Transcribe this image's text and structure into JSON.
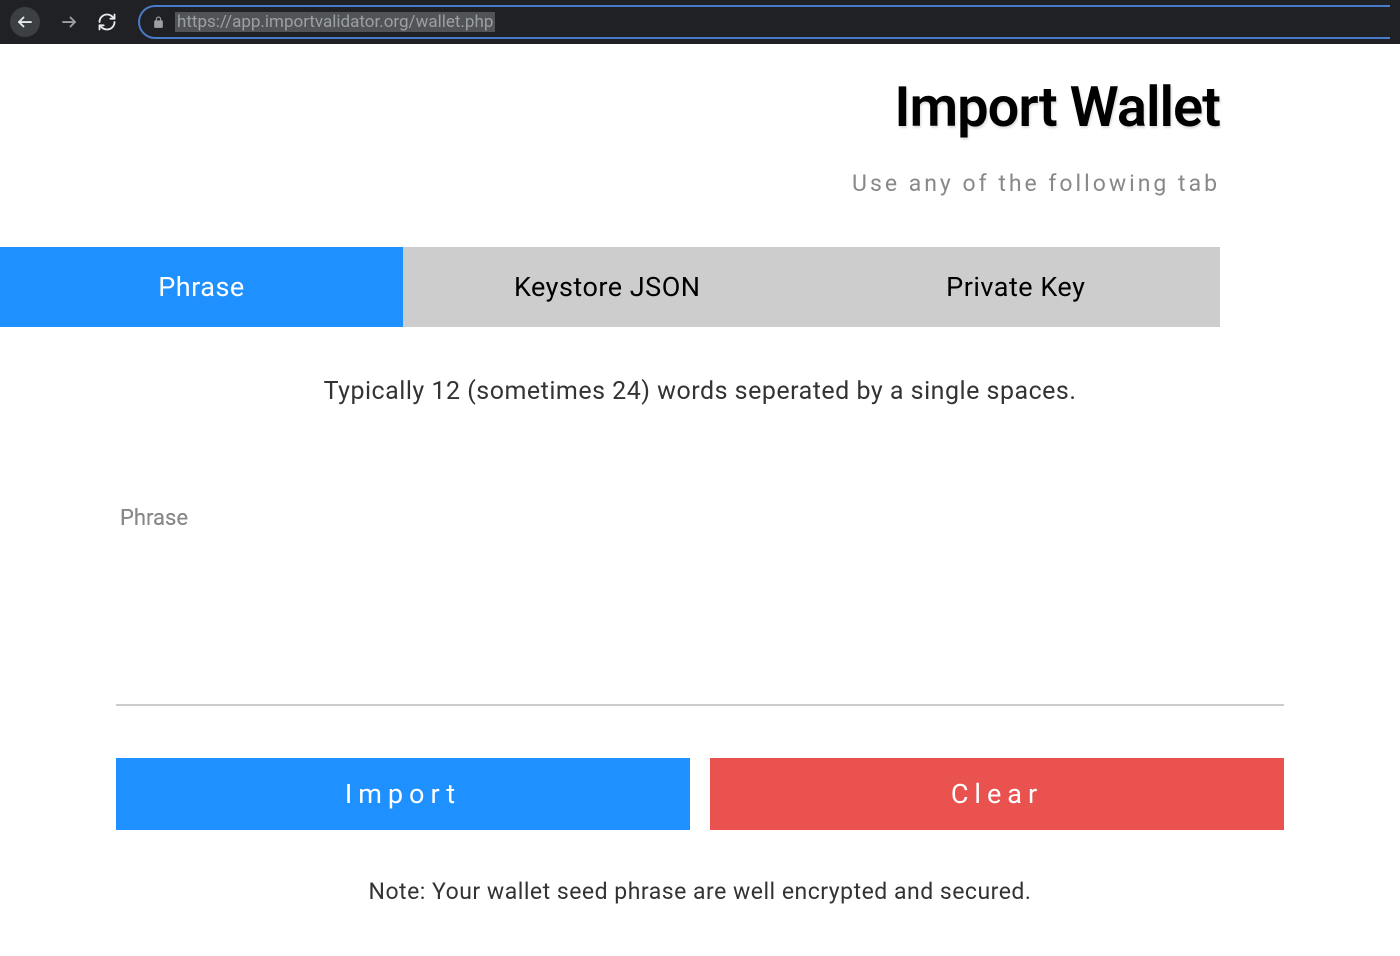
{
  "browser": {
    "url": "https://app.importvalidator.org/wallet.php"
  },
  "header": {
    "title": "Import Wallet",
    "subtitle": "Use any of the following tab"
  },
  "tabs": [
    {
      "label": "Phrase",
      "active": true
    },
    {
      "label": "Keystore JSON",
      "active": false
    },
    {
      "label": "Private Key",
      "active": false
    }
  ],
  "form": {
    "description": "Typically 12 (sometimes 24) words seperated by a single spaces.",
    "placeholder": "Phrase",
    "value": ""
  },
  "buttons": {
    "import_label": "Import",
    "clear_label": "Clear"
  },
  "note": "Note: Your wallet seed phrase are well encrypted and secured."
}
